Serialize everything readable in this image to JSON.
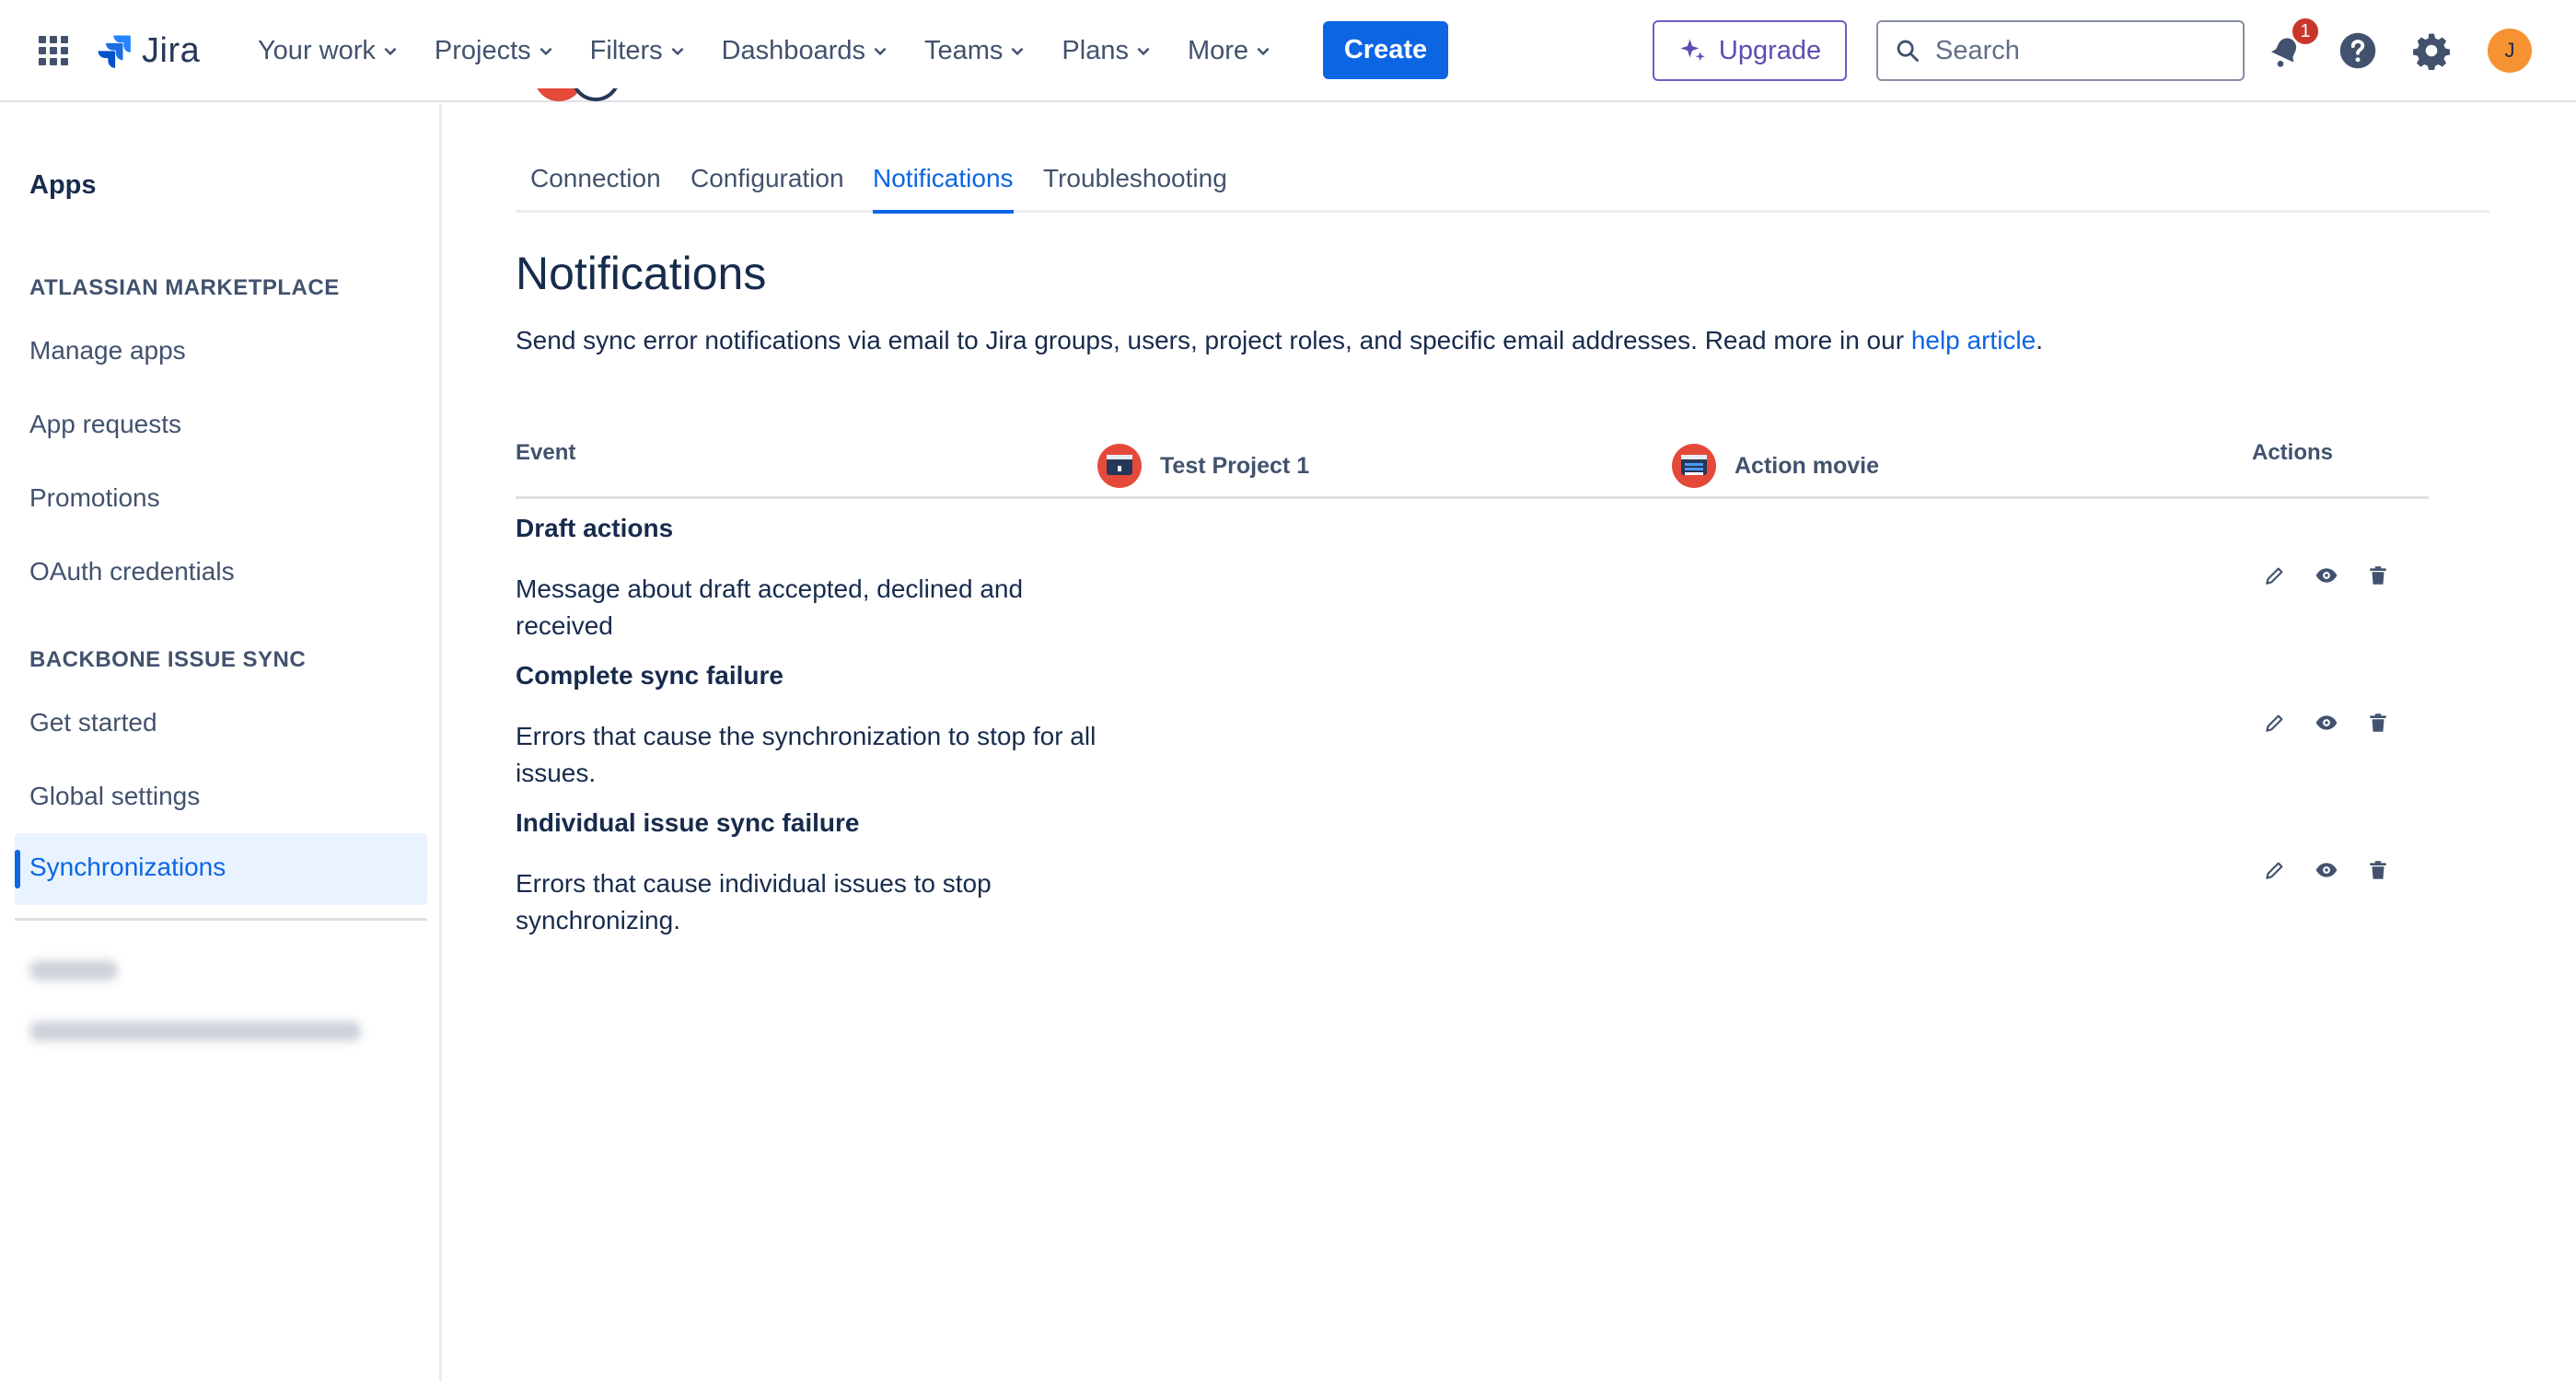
{
  "topnav": {
    "logo_text": "Jira",
    "items": [
      "Your work",
      "Projects",
      "Filters",
      "Dashboards",
      "Teams",
      "Plans",
      "More"
    ],
    "create_label": "Create",
    "upgrade_label": "Upgrade",
    "search_placeholder": "Search",
    "notification_count": "1",
    "avatar_initial": "J",
    "colors": {
      "primary": "#0c66e4",
      "upgrade": "#5e4db2",
      "badge": "#c9372c",
      "avatar": "#f79232"
    }
  },
  "sidebar": {
    "title": "Apps",
    "sections": [
      {
        "heading": "ATLASSIAN MARKETPLACE",
        "items": [
          "Manage apps",
          "App requests",
          "Promotions",
          "OAuth credentials"
        ]
      },
      {
        "heading": "BACKBONE ISSUE SYNC",
        "items": [
          "Get started",
          "Global settings",
          "Synchronizations"
        ]
      }
    ],
    "active_item": "Synchronizations"
  },
  "tabs": [
    "Connection",
    "Configuration",
    "Notifications",
    "Troubleshooting"
  ],
  "active_tab": "Notifications",
  "page": {
    "title": "Notifications",
    "description": "Send sync error notifications via email to Jira groups, users, project roles, and specific email addresses. Read more in our ",
    "help_link": "help article",
    "description_end": "."
  },
  "table": {
    "headers": {
      "event": "Event",
      "project1": "Test Project 1",
      "project2": "Action movie",
      "actions": "Actions"
    },
    "rows": [
      {
        "title": "Draft actions",
        "description": "Message about draft accepted, declined and received"
      },
      {
        "title": "Complete sync failure",
        "description": "Errors that cause the synchronization to stop for all issues."
      },
      {
        "title": "Individual issue sync failure",
        "description": "Errors that cause individual issues to stop synchronizing."
      }
    ],
    "action_icons": [
      "edit-icon",
      "view-icon",
      "delete-icon"
    ]
  }
}
